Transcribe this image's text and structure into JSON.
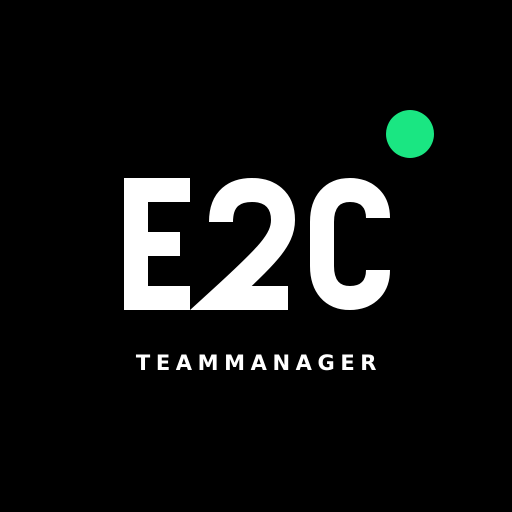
{
  "logo": {
    "wordmark": "E2C",
    "subtitle": "TEAMMANAGER",
    "icon": "green-dot-icon"
  },
  "colors": {
    "background": "#000000",
    "text": "#ffffff",
    "accent": "#1ae682"
  }
}
